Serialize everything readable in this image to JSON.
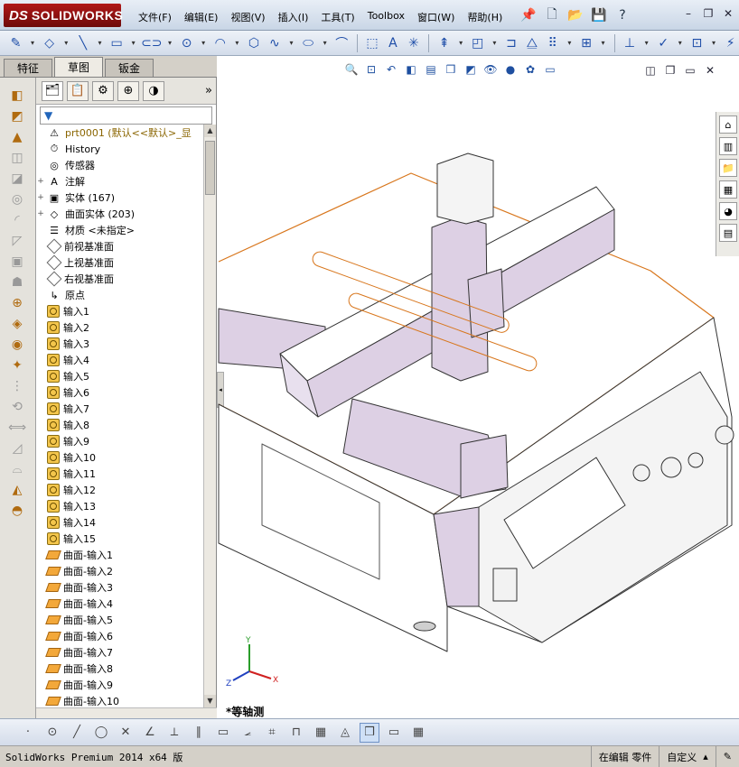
{
  "app": {
    "logo_prefix": "DS",
    "logo_name": "SOLIDWORKS"
  },
  "menu": [
    "文件(F)",
    "编辑(E)",
    "视图(V)",
    "插入(I)",
    "工具(T)",
    "Toolbox",
    "窗口(W)",
    "帮助(H)"
  ],
  "cmd_tabs": [
    "特征",
    "草图",
    "钣金"
  ],
  "active_tab": "草图",
  "tree": {
    "root": "prt0001  (默认<<默认>_显",
    "fixed_items": [
      {
        "label": "History",
        "icon": "history-icon",
        "expander": ""
      },
      {
        "label": "传感器",
        "icon": "sensor-icon",
        "expander": ""
      },
      {
        "label": "注解",
        "icon": "annotation-icon",
        "expander": "+"
      },
      {
        "label": "实体 (167)",
        "icon": "solid-bodies-icon",
        "expander": "+"
      },
      {
        "label": "曲面实体 (203)",
        "icon": "surface-bodies-icon",
        "expander": "+"
      },
      {
        "label": "材质 <未指定>",
        "icon": "material-icon",
        "expander": ""
      },
      {
        "label": "前视基准面",
        "icon": "plane-icon",
        "expander": ""
      },
      {
        "label": "上视基准面",
        "icon": "plane-icon",
        "expander": ""
      },
      {
        "label": "右视基准面",
        "icon": "plane-icon",
        "expander": ""
      },
      {
        "label": "原点",
        "icon": "origin-icon",
        "expander": ""
      }
    ],
    "imports": [
      "输入1",
      "输入2",
      "输入3",
      "输入4",
      "输入5",
      "输入6",
      "输入7",
      "输入8",
      "输入9",
      "输入10",
      "输入11",
      "输入12",
      "输入13",
      "输入14",
      "输入15"
    ],
    "surface_imports": [
      "曲面-输入1",
      "曲面-输入2",
      "曲面-输入3",
      "曲面-输入4",
      "曲面-输入5",
      "曲面-输入6",
      "曲面-输入7",
      "曲面-输入8",
      "曲面-输入9",
      "曲面-输入10"
    ]
  },
  "view": {
    "orientation": "*等轴测",
    "axes": {
      "x": "X",
      "y": "Y",
      "z": "Z"
    }
  },
  "status": {
    "product": "SolidWorks Premium 2014 x64 版",
    "editing": "在编辑 零件",
    "units": "自定义"
  },
  "colors": {
    "part_body": "#ddd0e4",
    "edge": "#333333",
    "sketch_orange": "#d8761c",
    "menubar": "#c9d6e6",
    "tree_root": "#8a6500"
  }
}
